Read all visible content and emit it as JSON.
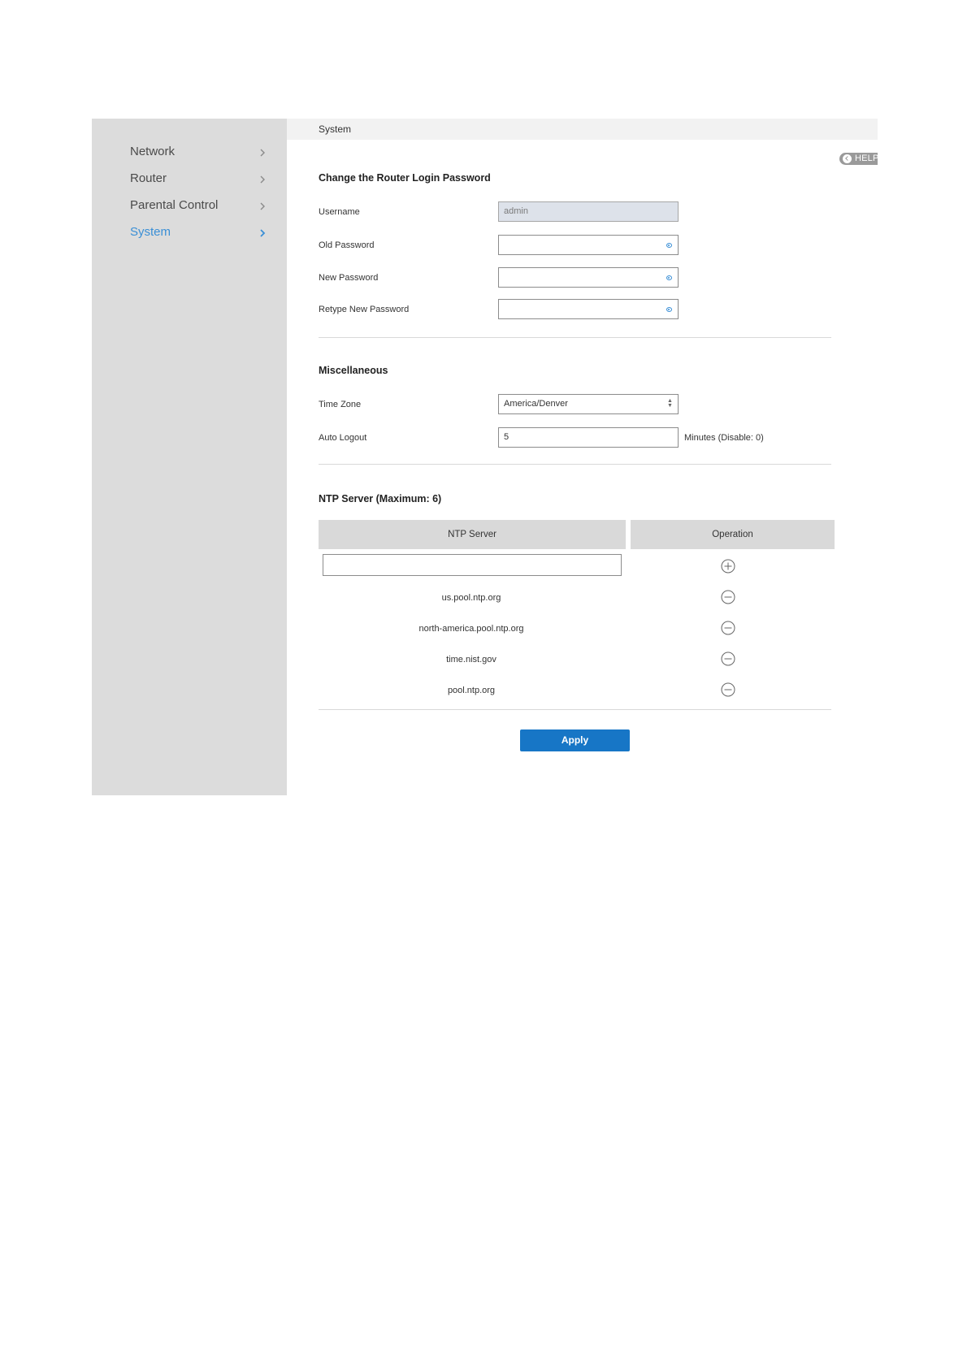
{
  "sidebar": {
    "items": [
      {
        "label": "Network",
        "active": false
      },
      {
        "label": "Router",
        "active": false
      },
      {
        "label": "Parental Control",
        "active": false
      },
      {
        "label": "System",
        "active": true
      }
    ]
  },
  "breadcrumb": "System",
  "help_label": "HELP",
  "password_section": {
    "title": "Change the Router Login Password",
    "username_label": "Username",
    "username_value": "admin",
    "old_password_label": "Old Password",
    "new_password_label": "New Password",
    "retype_password_label": "Retype New Password"
  },
  "misc_section": {
    "title": "Miscellaneous",
    "timezone_label": "Time Zone",
    "timezone_value": "America/Denver",
    "autologout_label": "Auto Logout",
    "autologout_value": "5",
    "autologout_suffix": "Minutes (Disable: 0)"
  },
  "ntp_section": {
    "title": "NTP Server (Maximum: 6)",
    "col_server": "NTP Server",
    "col_operation": "Operation",
    "servers": [
      "us.pool.ntp.org",
      "north-america.pool.ntp.org",
      "time.nist.gov",
      "pool.ntp.org"
    ]
  },
  "apply_label": "Apply",
  "colors": {
    "sidebar_bg": "#dcdcdc",
    "active_nav": "#3a8fd6",
    "apply_button": "#1776c6"
  }
}
